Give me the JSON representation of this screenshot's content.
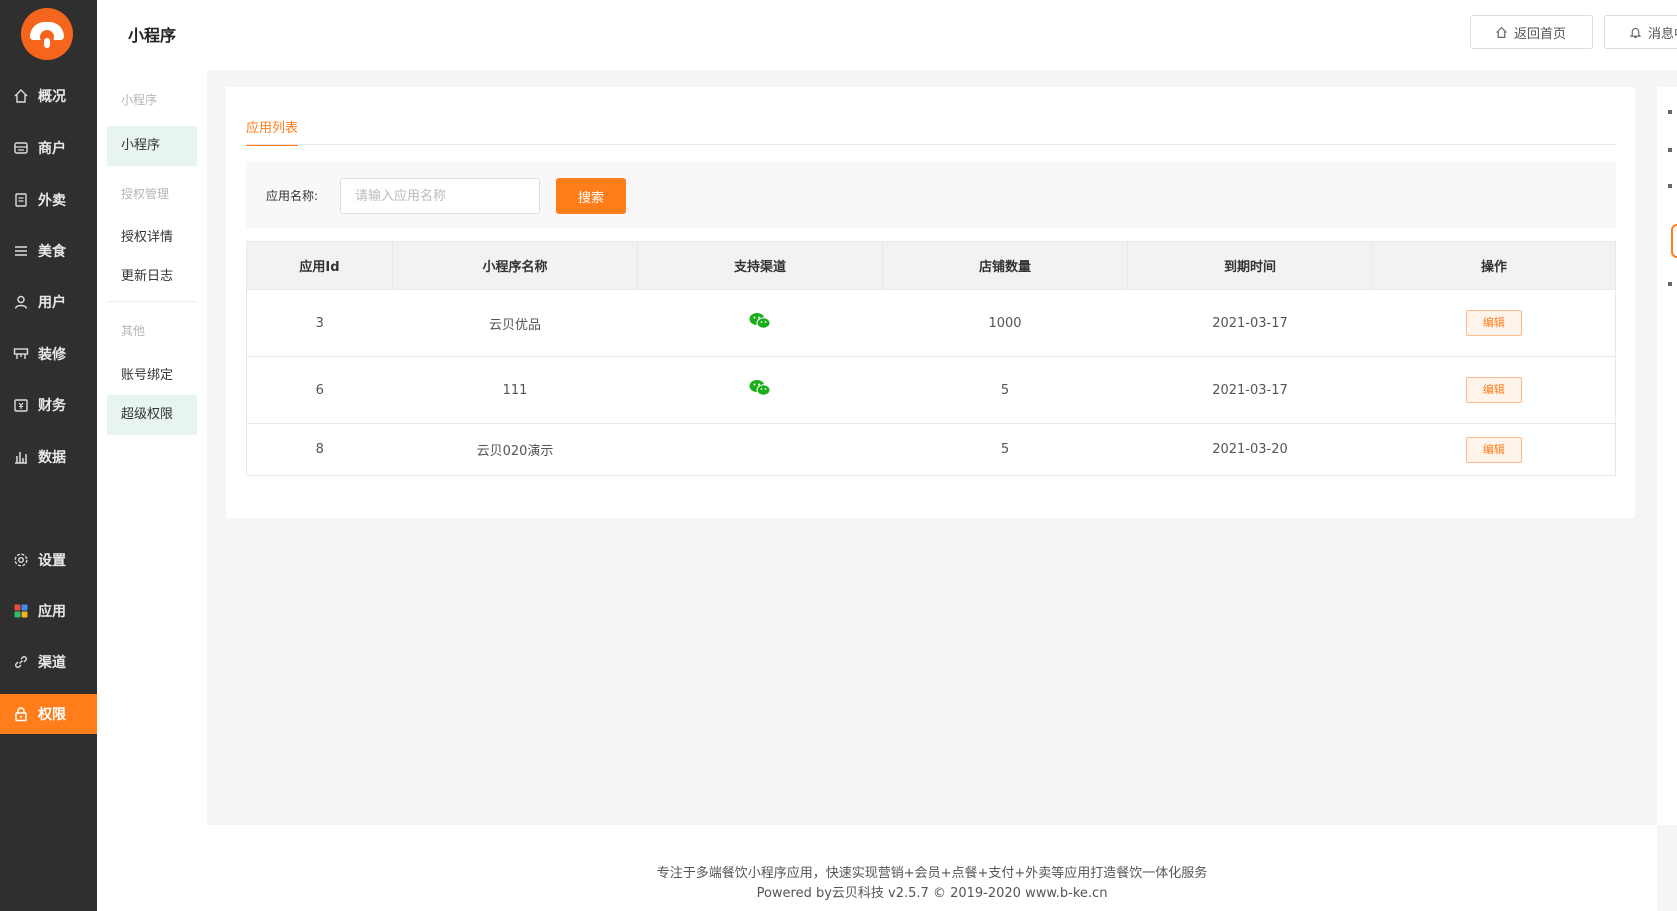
{
  "header": {
    "title": "小程序",
    "home_button": "返回首页",
    "message_button": "消息中"
  },
  "nav": {
    "items": [
      {
        "label": "概况",
        "icon": "home-icon"
      },
      {
        "label": "商户",
        "icon": "merchant-icon"
      },
      {
        "label": "外卖",
        "icon": "takeout-icon"
      },
      {
        "label": "美食",
        "icon": "menu-icon"
      },
      {
        "label": "用户",
        "icon": "user-icon"
      },
      {
        "label": "装修",
        "icon": "decorate-icon"
      },
      {
        "label": "财务",
        "icon": "finance-icon"
      },
      {
        "label": "数据",
        "icon": "chart-icon"
      },
      {
        "label": "设置",
        "icon": "gear-icon"
      },
      {
        "label": "应用",
        "icon": "apps-icon"
      },
      {
        "label": "渠道",
        "icon": "link-icon"
      },
      {
        "label": "权限",
        "icon": "lock-icon"
      }
    ],
    "active": "权限"
  },
  "subnav": {
    "group1": "小程序",
    "item_miniprogram": "小程序",
    "group2": "授权管理",
    "item_auth_detail": "授权详情",
    "item_changelog": "更新日志",
    "group3": "其他",
    "item_account_bind": "账号绑定",
    "item_super_perm": "超级权限"
  },
  "main": {
    "tab": "应用列表",
    "filter_label": "应用名称:",
    "filter_placeholder": "请输入应用名称",
    "search_button": "搜索",
    "columns": [
      "应用Id",
      "小程序名称",
      "支持渠道",
      "店铺数量",
      "到期时间",
      "操作"
    ],
    "rows": [
      {
        "id": "3",
        "name": "云贝优品",
        "wechat": true,
        "shops": "1000",
        "expire": "2021-03-17",
        "action": "编辑"
      },
      {
        "id": "6",
        "name": "111",
        "wechat": true,
        "shops": "5",
        "expire": "2021-03-17",
        "action": "编辑"
      },
      {
        "id": "8",
        "name": "云贝020演示",
        "wechat": false,
        "shops": "5",
        "expire": "2021-03-20",
        "action": "编辑"
      }
    ]
  },
  "footer": {
    "line1": "专注于多端餐饮小程序应用，快速实现营销+会员+点餐+支付+外卖等应用打造餐饮一体化服务",
    "line2": "Powered by云贝科技 v2.5.7 © 2019-2020 www.b-ke.cn"
  },
  "colors": {
    "accent": "#ff7d1a",
    "sidebar_bg": "#2f2f2f",
    "wechat": "#1aad19"
  }
}
